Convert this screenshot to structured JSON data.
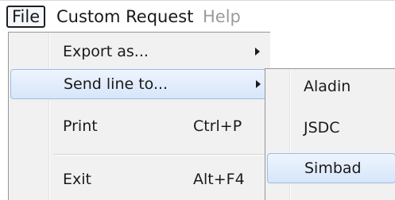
{
  "menubar": {
    "items": [
      {
        "label": "File",
        "state": "active"
      },
      {
        "label": "Custom Request",
        "state": "normal"
      },
      {
        "label": "Help",
        "state": "disabled"
      }
    ]
  },
  "file_menu": {
    "items": [
      {
        "label": "Export as...",
        "shortcut": "",
        "has_submenu": true
      },
      {
        "label": "Send line to...",
        "shortcut": "",
        "has_submenu": true,
        "highlighted": true
      },
      {
        "label": "Print",
        "shortcut": "Ctrl+P",
        "has_submenu": false
      },
      {
        "label": "Exit",
        "shortcut": "Alt+F4",
        "has_submenu": false
      }
    ]
  },
  "send_line_submenu": {
    "items": [
      {
        "label": "Aladin"
      },
      {
        "label": "JSDC"
      },
      {
        "label": "Simbad",
        "highlighted": true
      }
    ]
  },
  "colors": {
    "highlight_border": "#9bbde6",
    "highlight_fill": "#d6e6fa",
    "menu_bg": "#f1f1f1",
    "disabled_text": "#9a9a9a"
  }
}
